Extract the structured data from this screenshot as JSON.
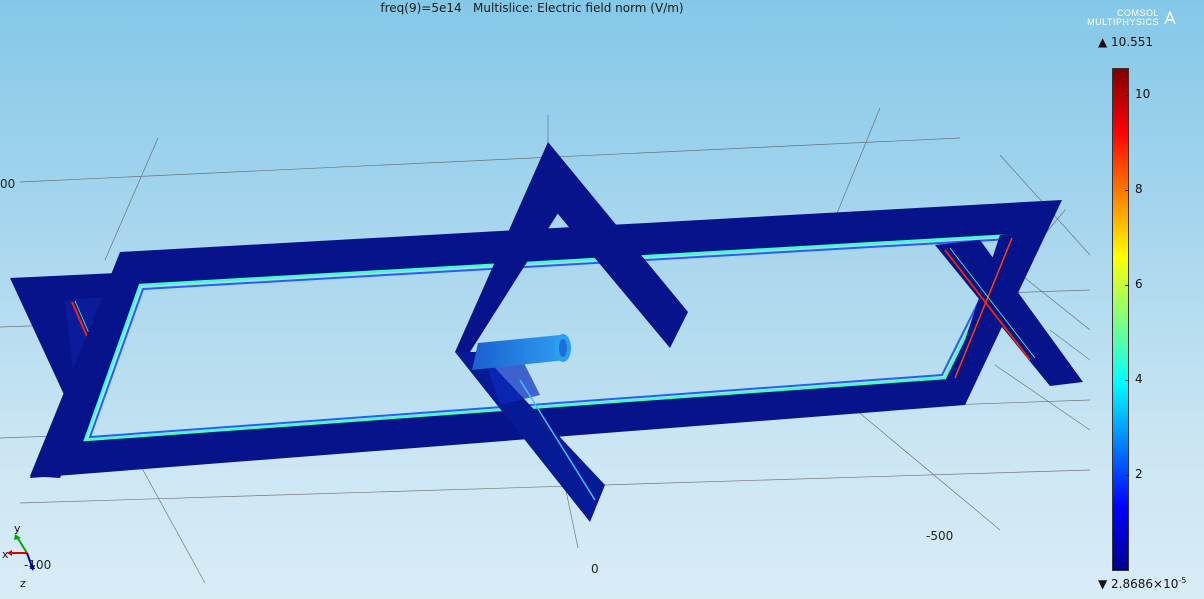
{
  "plot": {
    "title": "freq(9)=5e14   Multislice: Electric field norm (V/m)"
  },
  "logo": {
    "line1": "COMSOL",
    "line2": "MULTIPHYSICS"
  },
  "axes": {
    "labels": [
      {
        "text": "00"
      },
      {
        "text": "-100"
      },
      {
        "text": "0"
      },
      {
        "text": "-500"
      }
    ],
    "triad": {
      "x": "x",
      "y": "y",
      "z": "z"
    }
  },
  "colorbar": {
    "max_label": "▲ 10.551",
    "min_label": "▼ 2.8686×10",
    "min_exp": "-5",
    "min_value": 2.8686e-05,
    "max_value": 10.551,
    "ticks": [
      {
        "label": "10",
        "value": 10
      },
      {
        "label": "8",
        "value": 8
      },
      {
        "label": "6",
        "value": 6
      },
      {
        "label": "4",
        "value": 4
      },
      {
        "label": "2",
        "value": 2
      }
    ],
    "colormap": "rainbow"
  },
  "colors": {
    "background_top": "#84c8e8",
    "background_bottom": "#d8ecf6",
    "structure": "#06138a",
    "hot_edge": "#ff2000",
    "warm_edge": "#40ffc0"
  }
}
